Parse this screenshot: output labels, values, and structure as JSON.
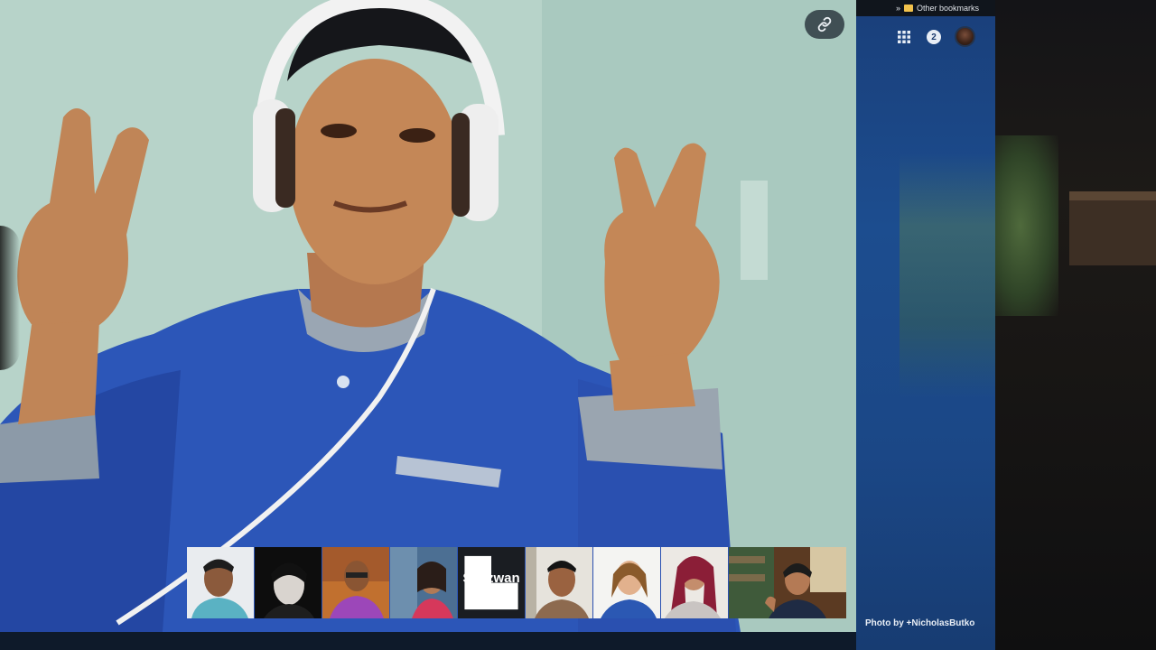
{
  "bookmarks_bar": {
    "chevron": "»",
    "other_bookmarks_label": "Other bookmarks"
  },
  "top_bar": {
    "apps_icon": "apps-grid-icon",
    "notification_count": "2",
    "account_avatar": "account-avatar"
  },
  "main_video": {
    "link_button_icon": "link-icon"
  },
  "participants": [
    {
      "type": "video",
      "icon": "participant-video"
    },
    {
      "type": "video",
      "icon": "participant-video"
    },
    {
      "type": "video",
      "icon": "participant-video"
    },
    {
      "type": "video",
      "icon": "participant-video"
    },
    {
      "type": "name_card",
      "name": "Syazwan",
      "icon": "phone-icon"
    },
    {
      "type": "video",
      "icon": "participant-video"
    },
    {
      "type": "video",
      "icon": "participant-video"
    },
    {
      "type": "video",
      "icon": "participant-video"
    },
    {
      "type": "video",
      "icon": "participant-video"
    }
  ],
  "credit": "Photo by +NicholasButko",
  "colors": {
    "panel_blue": "#1c4d8f",
    "bookmarks_bar": "#10151c",
    "video_bg": "#aecdc2"
  }
}
